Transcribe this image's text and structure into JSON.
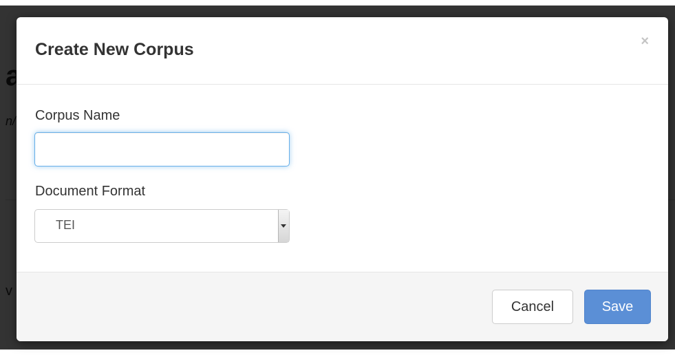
{
  "background_page": {
    "heading": "a",
    "subheading": "n/",
    "body_text": "v"
  },
  "modal": {
    "title": "Create New Corpus",
    "close_label": "×",
    "fields": {
      "corpus_name": {
        "label": "Corpus Name",
        "value": "",
        "placeholder": ""
      },
      "document_format": {
        "label": "Document Format",
        "selected": "TEI"
      }
    },
    "buttons": {
      "cancel": "Cancel",
      "save": "Save"
    }
  },
  "colors": {
    "primary": "#5b8fd6",
    "focus_border": "#66afe9",
    "text": "#333333"
  },
  "icons": {
    "close": "close-icon",
    "select_arrow": "chevron-down-icon"
  }
}
